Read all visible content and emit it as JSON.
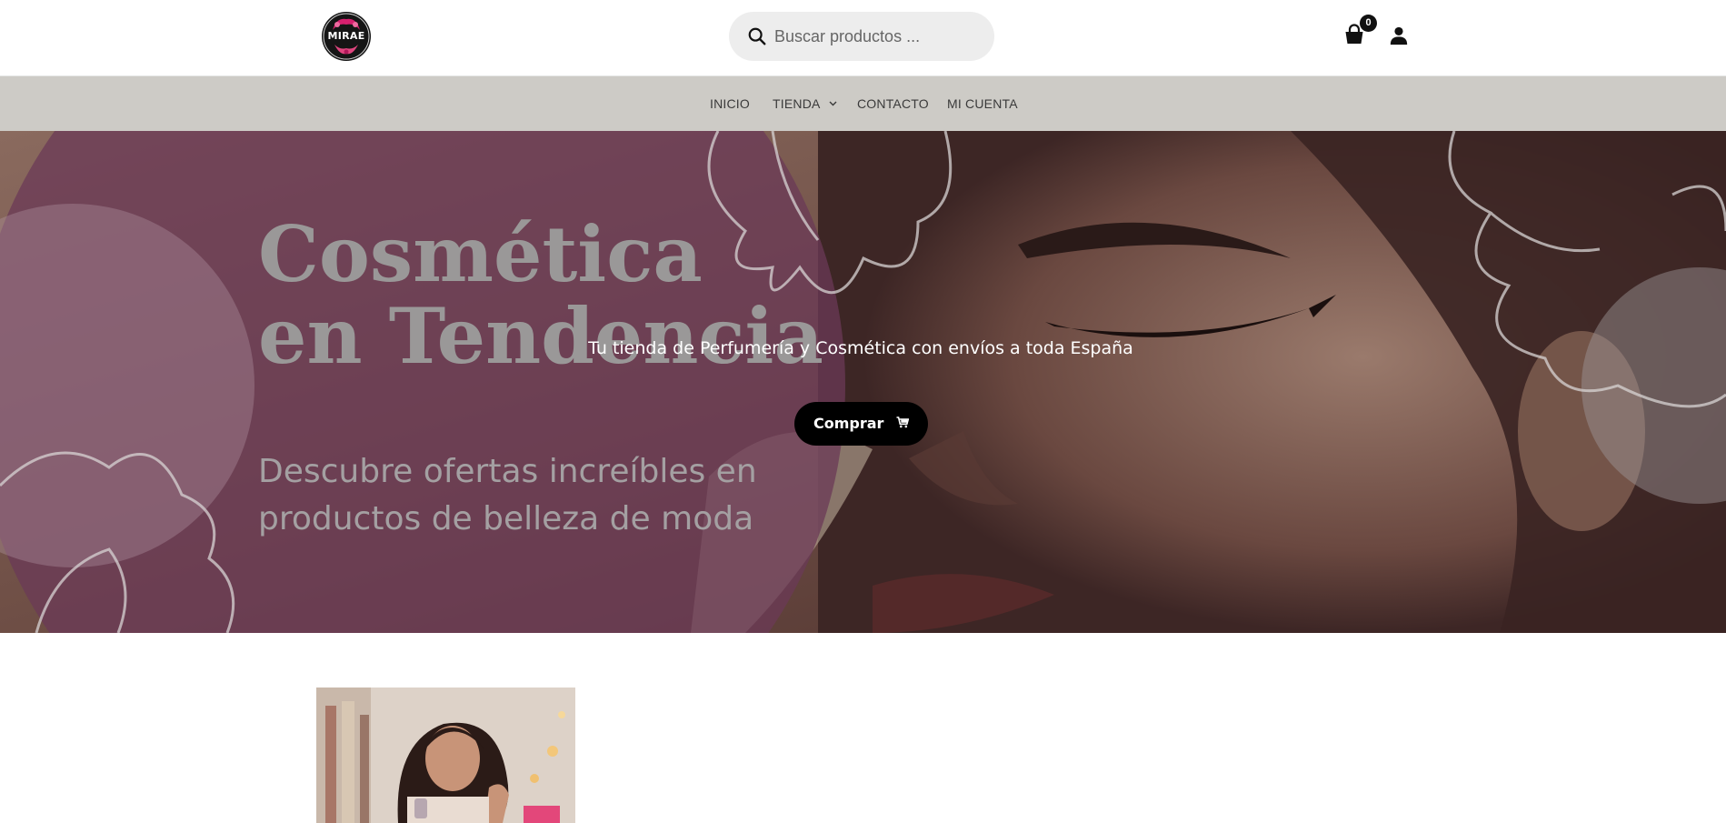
{
  "header": {
    "logo_text": "MIRAE",
    "search": {
      "placeholder": "Buscar productos ..."
    },
    "cart": {
      "count": "0"
    }
  },
  "nav": {
    "items": [
      {
        "label": "INICIO"
      },
      {
        "label": "TIENDA",
        "has_dropdown": true
      },
      {
        "label": "CONTACTO"
      },
      {
        "label": "MI CUENTA"
      }
    ]
  },
  "hero": {
    "title_line1": "Cosmética",
    "title_line2": "en Tendencia",
    "subtitle_line1": "Descubre ofertas increíbles en",
    "subtitle_line2": "productos de belleza de moda",
    "tagline": "Tu tienda de Perfumería y Cosmética con envíos a toda España",
    "button_label": "Comprar"
  },
  "colors": {
    "nav_bg": "#cdcbc6",
    "button_bg": "#000000",
    "search_bg": "#ededed",
    "hero_overlay": "#6b3a57"
  },
  "icons": [
    "search-icon",
    "shopping-bag-icon",
    "user-icon",
    "chevron-down-icon",
    "cart-icon"
  ]
}
